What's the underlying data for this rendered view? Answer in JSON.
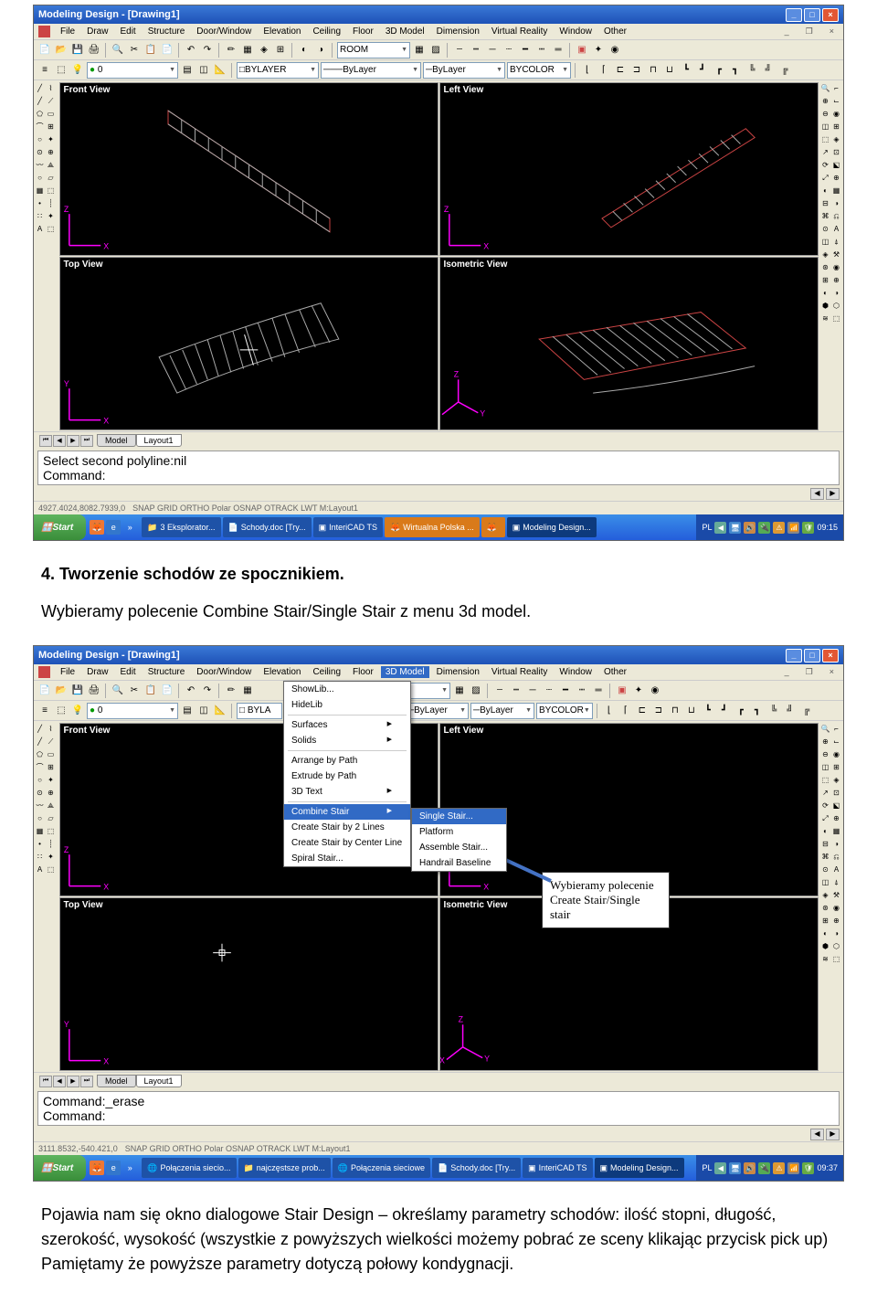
{
  "app": {
    "title": "Modeling Design - [Drawing1]"
  },
  "menu": {
    "items": [
      "File",
      "Draw",
      "Edit",
      "Structure",
      "Door/Window",
      "Elevation",
      "Ceiling",
      "Floor",
      "3D Model",
      "Dimension",
      "Virtual Reality",
      "Window",
      "Other"
    ]
  },
  "toolbar1": {
    "layer": "BYLAYER",
    "ltype": "ByLayer",
    "lwt": "ByLayer",
    "color": "BYCOLOR",
    "room": "ROOM",
    "zero": "0"
  },
  "views": {
    "front": "Front View",
    "left": "Left View",
    "top": "Top View",
    "iso": "Isometric View"
  },
  "tabs": {
    "model": "Model",
    "layout": "Layout1"
  },
  "cmd1": {
    "line1": "Select second polyline:nil",
    "line2": "Command:"
  },
  "cmd2": {
    "line1": "Command:_erase",
    "line2": "Command:"
  },
  "status1": {
    "coord": "4927.4024,8082.7939,0",
    "modes": "SNAP  GRID  ORTHO  Polar  OSNAP  OTRACK  LWT  M:Layout1"
  },
  "status2": {
    "coord": "3111.8532,-540.421,0",
    "modes": "SNAP  GRID  ORTHO  Polar  OSNAP  OTRACK  LWT  M:Layout1"
  },
  "taskbar1": {
    "start": "Start",
    "items": [
      "3 Eksplorator...",
      "Schody.doc [Try...",
      "InteriCAD TS",
      "Wirtualna Polska ...",
      "",
      "Modeling Design..."
    ],
    "lang": "PL",
    "time": "09:15"
  },
  "taskbar2": {
    "start": "Start",
    "items": [
      "Połączenia siecio...",
      "najczęstsze prob...",
      "Połączenia sieciowe",
      "Schody.doc [Try...",
      "InteriCAD TS",
      "Modeling Design..."
    ],
    "lang": "PL",
    "time": "09:37"
  },
  "doc": {
    "heading": "4. Tworzenie schodów ze spocznikiem.",
    "para1": "Wybieramy polecenie Combine Stair/Single Stair z menu 3d model.",
    "para2": "Pojawia nam się okno dialogowe Stair Design – określamy parametry schodów: ilość stopni, długość, szerokość, wysokość (wszystkie z powyższych wielkości możemy pobrać ze sceny klikając przycisk pick up) Pamiętamy że powyższe parametry dotyczą połowy kondygnacji."
  },
  "dropdown": {
    "g1": [
      "ShowLib...",
      "HideLib"
    ],
    "g2": [
      {
        "l": "Surfaces",
        "a": true
      },
      {
        "l": "Solids",
        "a": true
      }
    ],
    "g3": [
      "Arrange by Path",
      "Extrude by Path",
      {
        "l": "3D Text",
        "a": true
      }
    ],
    "g4": [
      {
        "l": "Combine Stair",
        "a": true,
        "hl": true
      },
      "Create Stair by 2 Lines",
      "Create Stair by Center Line",
      "Spiral Stair..."
    ],
    "sub": [
      "Single Stair...",
      "Platform",
      "Assemble Stair...",
      "Handrail Baseline"
    ]
  },
  "callout": "Wybieramy polecenie Create Stair/Single stair"
}
